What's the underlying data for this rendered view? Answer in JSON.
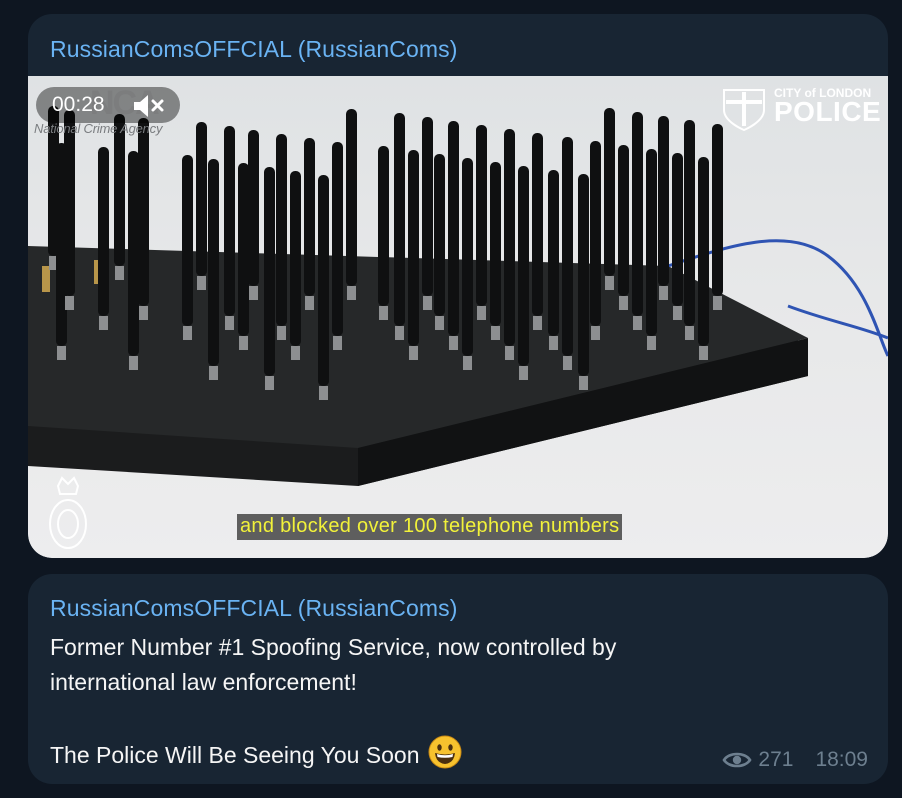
{
  "messages": [
    {
      "sender": "RussianComsOFFCIAL (RussianComs)",
      "video": {
        "duration": "00:28",
        "muted": true,
        "watermarks": {
          "nca_logo": "NCA",
          "nca_name": "National Crime Agency",
          "police_city": "CITY of LONDON",
          "police_name": "POLICE"
        },
        "caption": "and blocked over 100 telephone numbers"
      }
    },
    {
      "sender": "RussianComsOFFCIAL (RussianComs)",
      "text_line1": "Former Number #1 Spoofing Service, now controlled by",
      "text_line2": "international law enforcement!",
      "text_line3": "The Police Will Be Seeing You Soon",
      "emoji": "grinning-face",
      "views": "271",
      "time": "18:09"
    }
  ],
  "colors": {
    "background": "#0e1621",
    "bubble": "#182533",
    "sender": "#6ab3f3",
    "text": "#f5f5f5",
    "meta": "#6d7f8f",
    "caption_text": "#f2f23a"
  }
}
